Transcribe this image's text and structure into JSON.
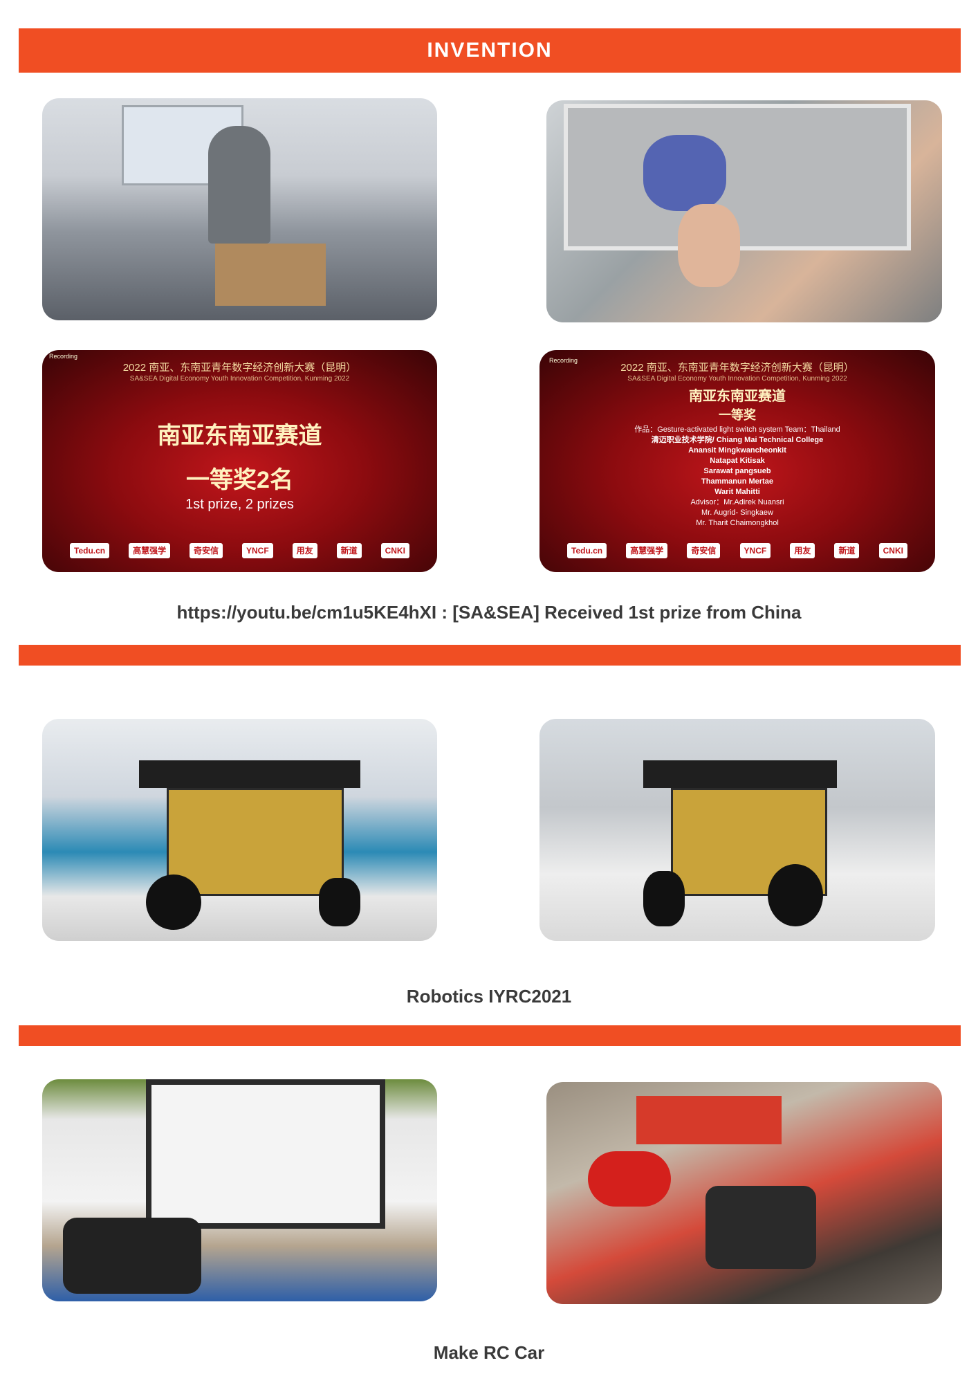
{
  "sections": [
    {
      "title": "INVENTION"
    },
    {
      "title": ""
    },
    {
      "title": ""
    }
  ],
  "invention": {
    "caption": "https://youtu.be/cm1u5KE4hXI :  [SA&SEA] Received 1st prize from China",
    "stage_left": {
      "recording": "Recording",
      "header": "2022 南亚、东南亚青年数字经济创新大赛（昆明）",
      "subheader": "SA&SEA Digital Economy Youth Innovation Competition, Kunming 2022",
      "track": "南亚东南亚赛道",
      "prize_cn": "一等奖2名",
      "prize_en": "1st prize, 2 prizes"
    },
    "stage_right": {
      "recording": "Recording",
      "header": "2022 南亚、东南亚青年数字经济创新大赛（昆明）",
      "subheader": "SA&SEA Digital Economy Youth Innovation Competition, Kunming 2022",
      "track": "南亚东南亚赛道",
      "prize_cn": "一等奖",
      "work_line": "作品：Gesture-activated light switch system Team：Thailand",
      "school_line": "清迈职业技术学院/ Chiang Mai Technical College",
      "members": [
        "Anansit Mingkwancheonkit",
        "Natapat Kitisak",
        "Sarawat pangsueb",
        "Thammanun Mertae",
        "Warit Mahitti"
      ],
      "advisors": [
        "Advisor：Mr.Adirek Nuansri",
        "Mr. Augrid- Singkaew",
        "Mr. Tharit Chaimongkhol"
      ]
    },
    "logos": [
      "Tedu.cn",
      "高慧强学",
      "奇安信",
      "YNCF",
      "用友",
      "新道",
      "CNKI"
    ]
  },
  "robotics": {
    "caption": "Robotics IYRC2021"
  },
  "rccar": {
    "caption": "Make RC Car"
  },
  "colors": {
    "accent": "#f04e23",
    "caption_text": "#3a3a3a"
  }
}
